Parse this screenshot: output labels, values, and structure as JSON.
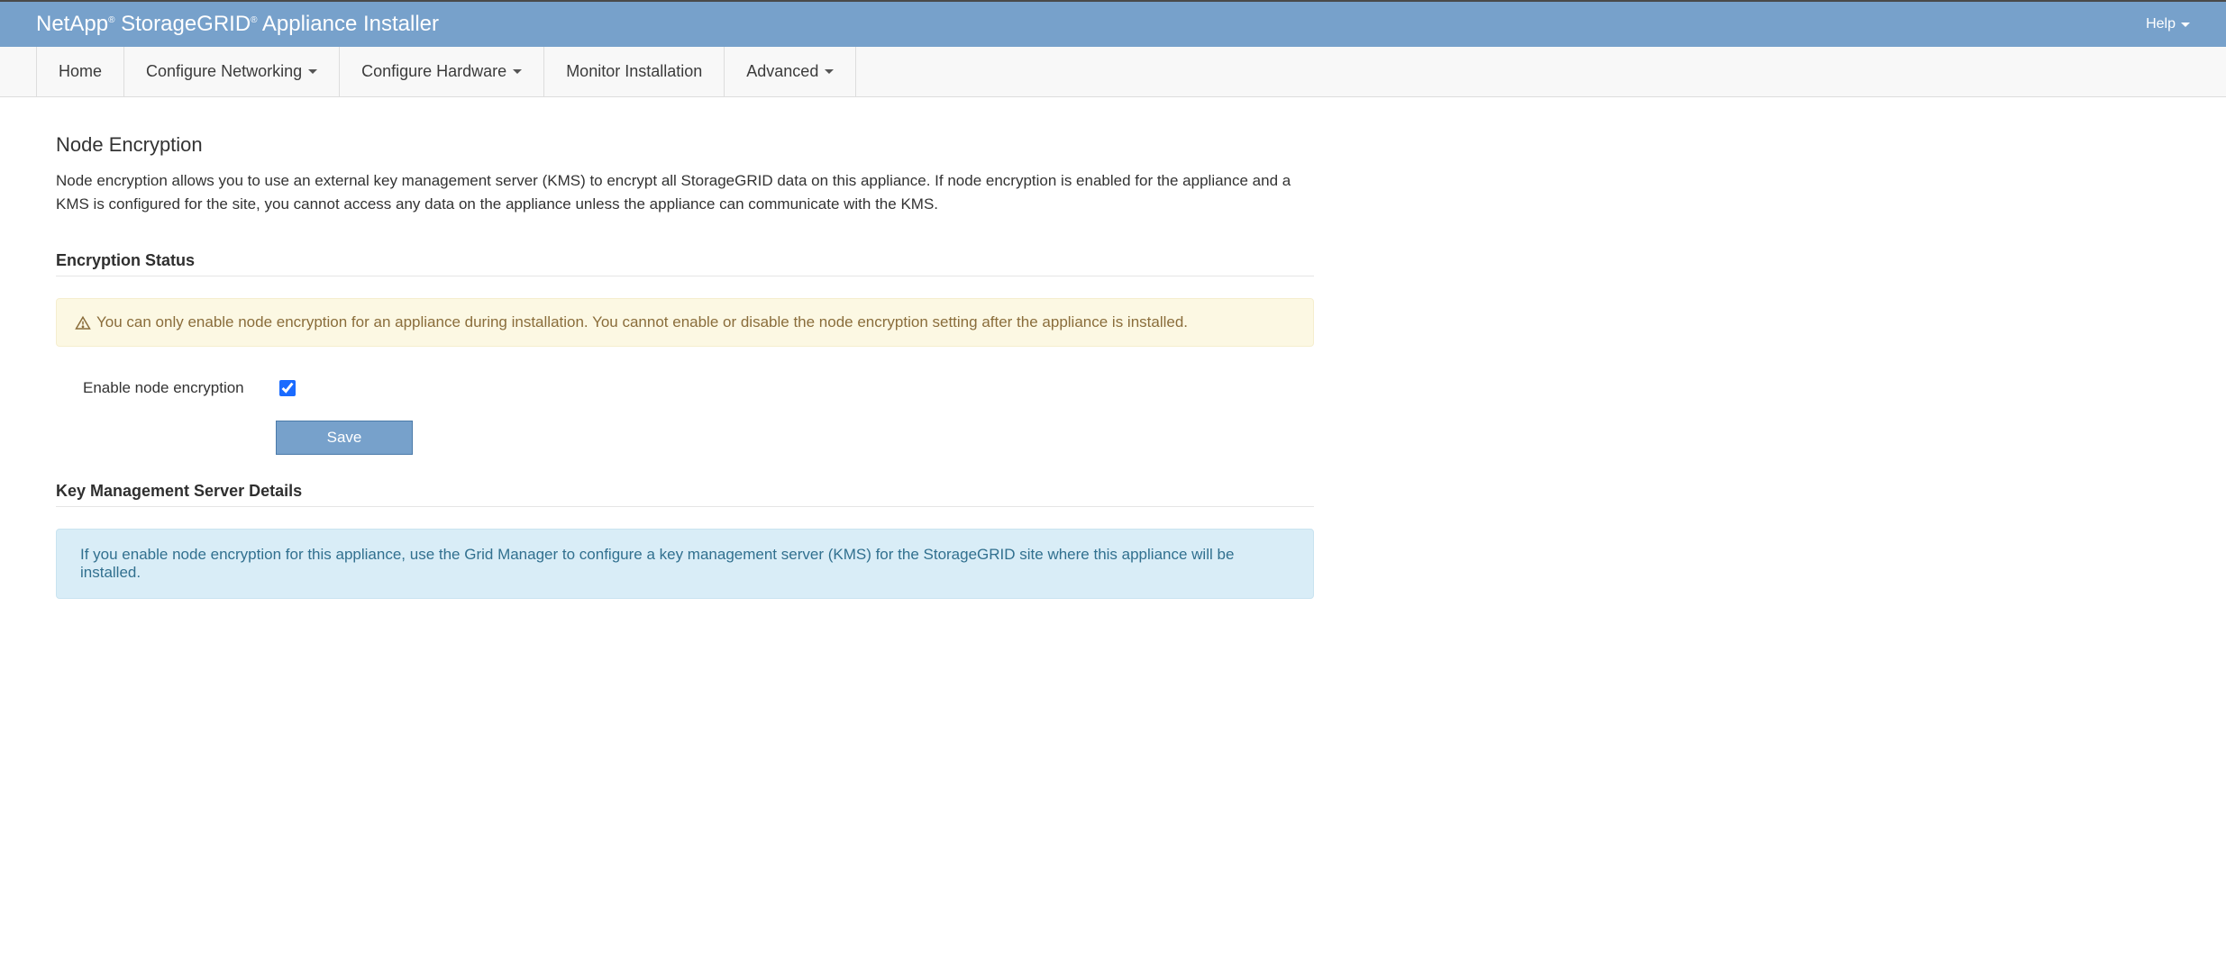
{
  "header": {
    "brand_1": "NetApp",
    "brand_2": " StorageGRID",
    "brand_3": " Appliance Installer",
    "reg": "®",
    "help_label": "Help"
  },
  "nav": {
    "home": "Home",
    "configure_networking": "Configure Networking",
    "configure_hardware": "Configure Hardware",
    "monitor_installation": "Monitor Installation",
    "advanced": "Advanced"
  },
  "page": {
    "title": "Node Encryption",
    "description": "Node encryption allows you to use an external key management server (KMS) to encrypt all StorageGRID data on this appliance. If node encryption is enabled for the appliance and a KMS is configured for the site, you cannot access any data on the appliance unless the appliance can communicate with the KMS."
  },
  "encryption_status": {
    "heading": "Encryption Status",
    "warning_text": "You can only enable node encryption for an appliance during installation. You cannot enable or disable the node encryption setting after the appliance is installed.",
    "enable_label": "Enable node encryption",
    "enable_checked": true,
    "save_label": "Save"
  },
  "kms": {
    "heading": "Key Management Server Details",
    "info_text": "If you enable node encryption for this appliance, use the Grid Manager to configure a key management server (KMS) for the StorageGRID site where this appliance will be installed."
  }
}
